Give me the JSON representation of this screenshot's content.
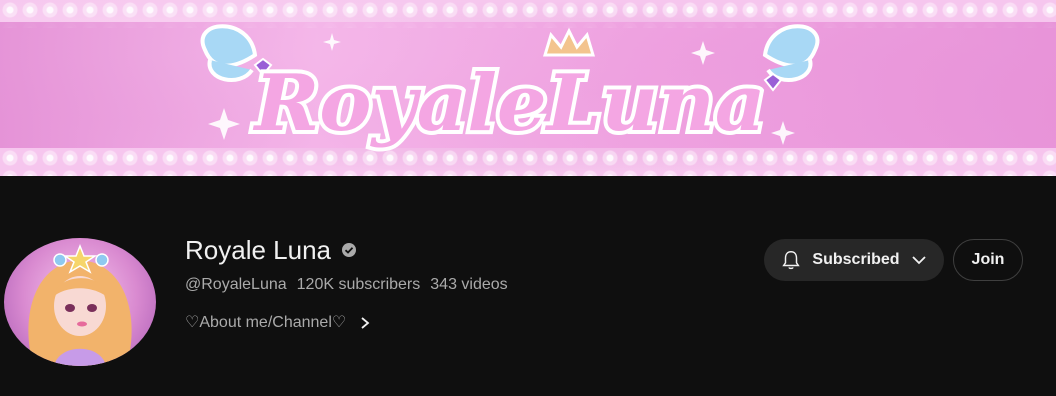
{
  "banner": {
    "logo_text": "RoyaleLuna",
    "colors": {
      "pink": "#ef9ee0",
      "lightblue": "#9fd3f2",
      "crown": "#f3c48e"
    }
  },
  "channel": {
    "name": "Royale Luna",
    "handle": "@RoyaleLuna",
    "subscribers": "120K subscribers",
    "videos": "343 videos",
    "about": "♡About me/Channel♡"
  },
  "actions": {
    "subscribed_label": "Subscribed",
    "join_label": "Join"
  },
  "icons": {
    "verified": "verified-check-icon",
    "bell": "bell-icon",
    "chevron_down": "chevron-down-icon",
    "chevron_right": "chevron-right-icon"
  }
}
